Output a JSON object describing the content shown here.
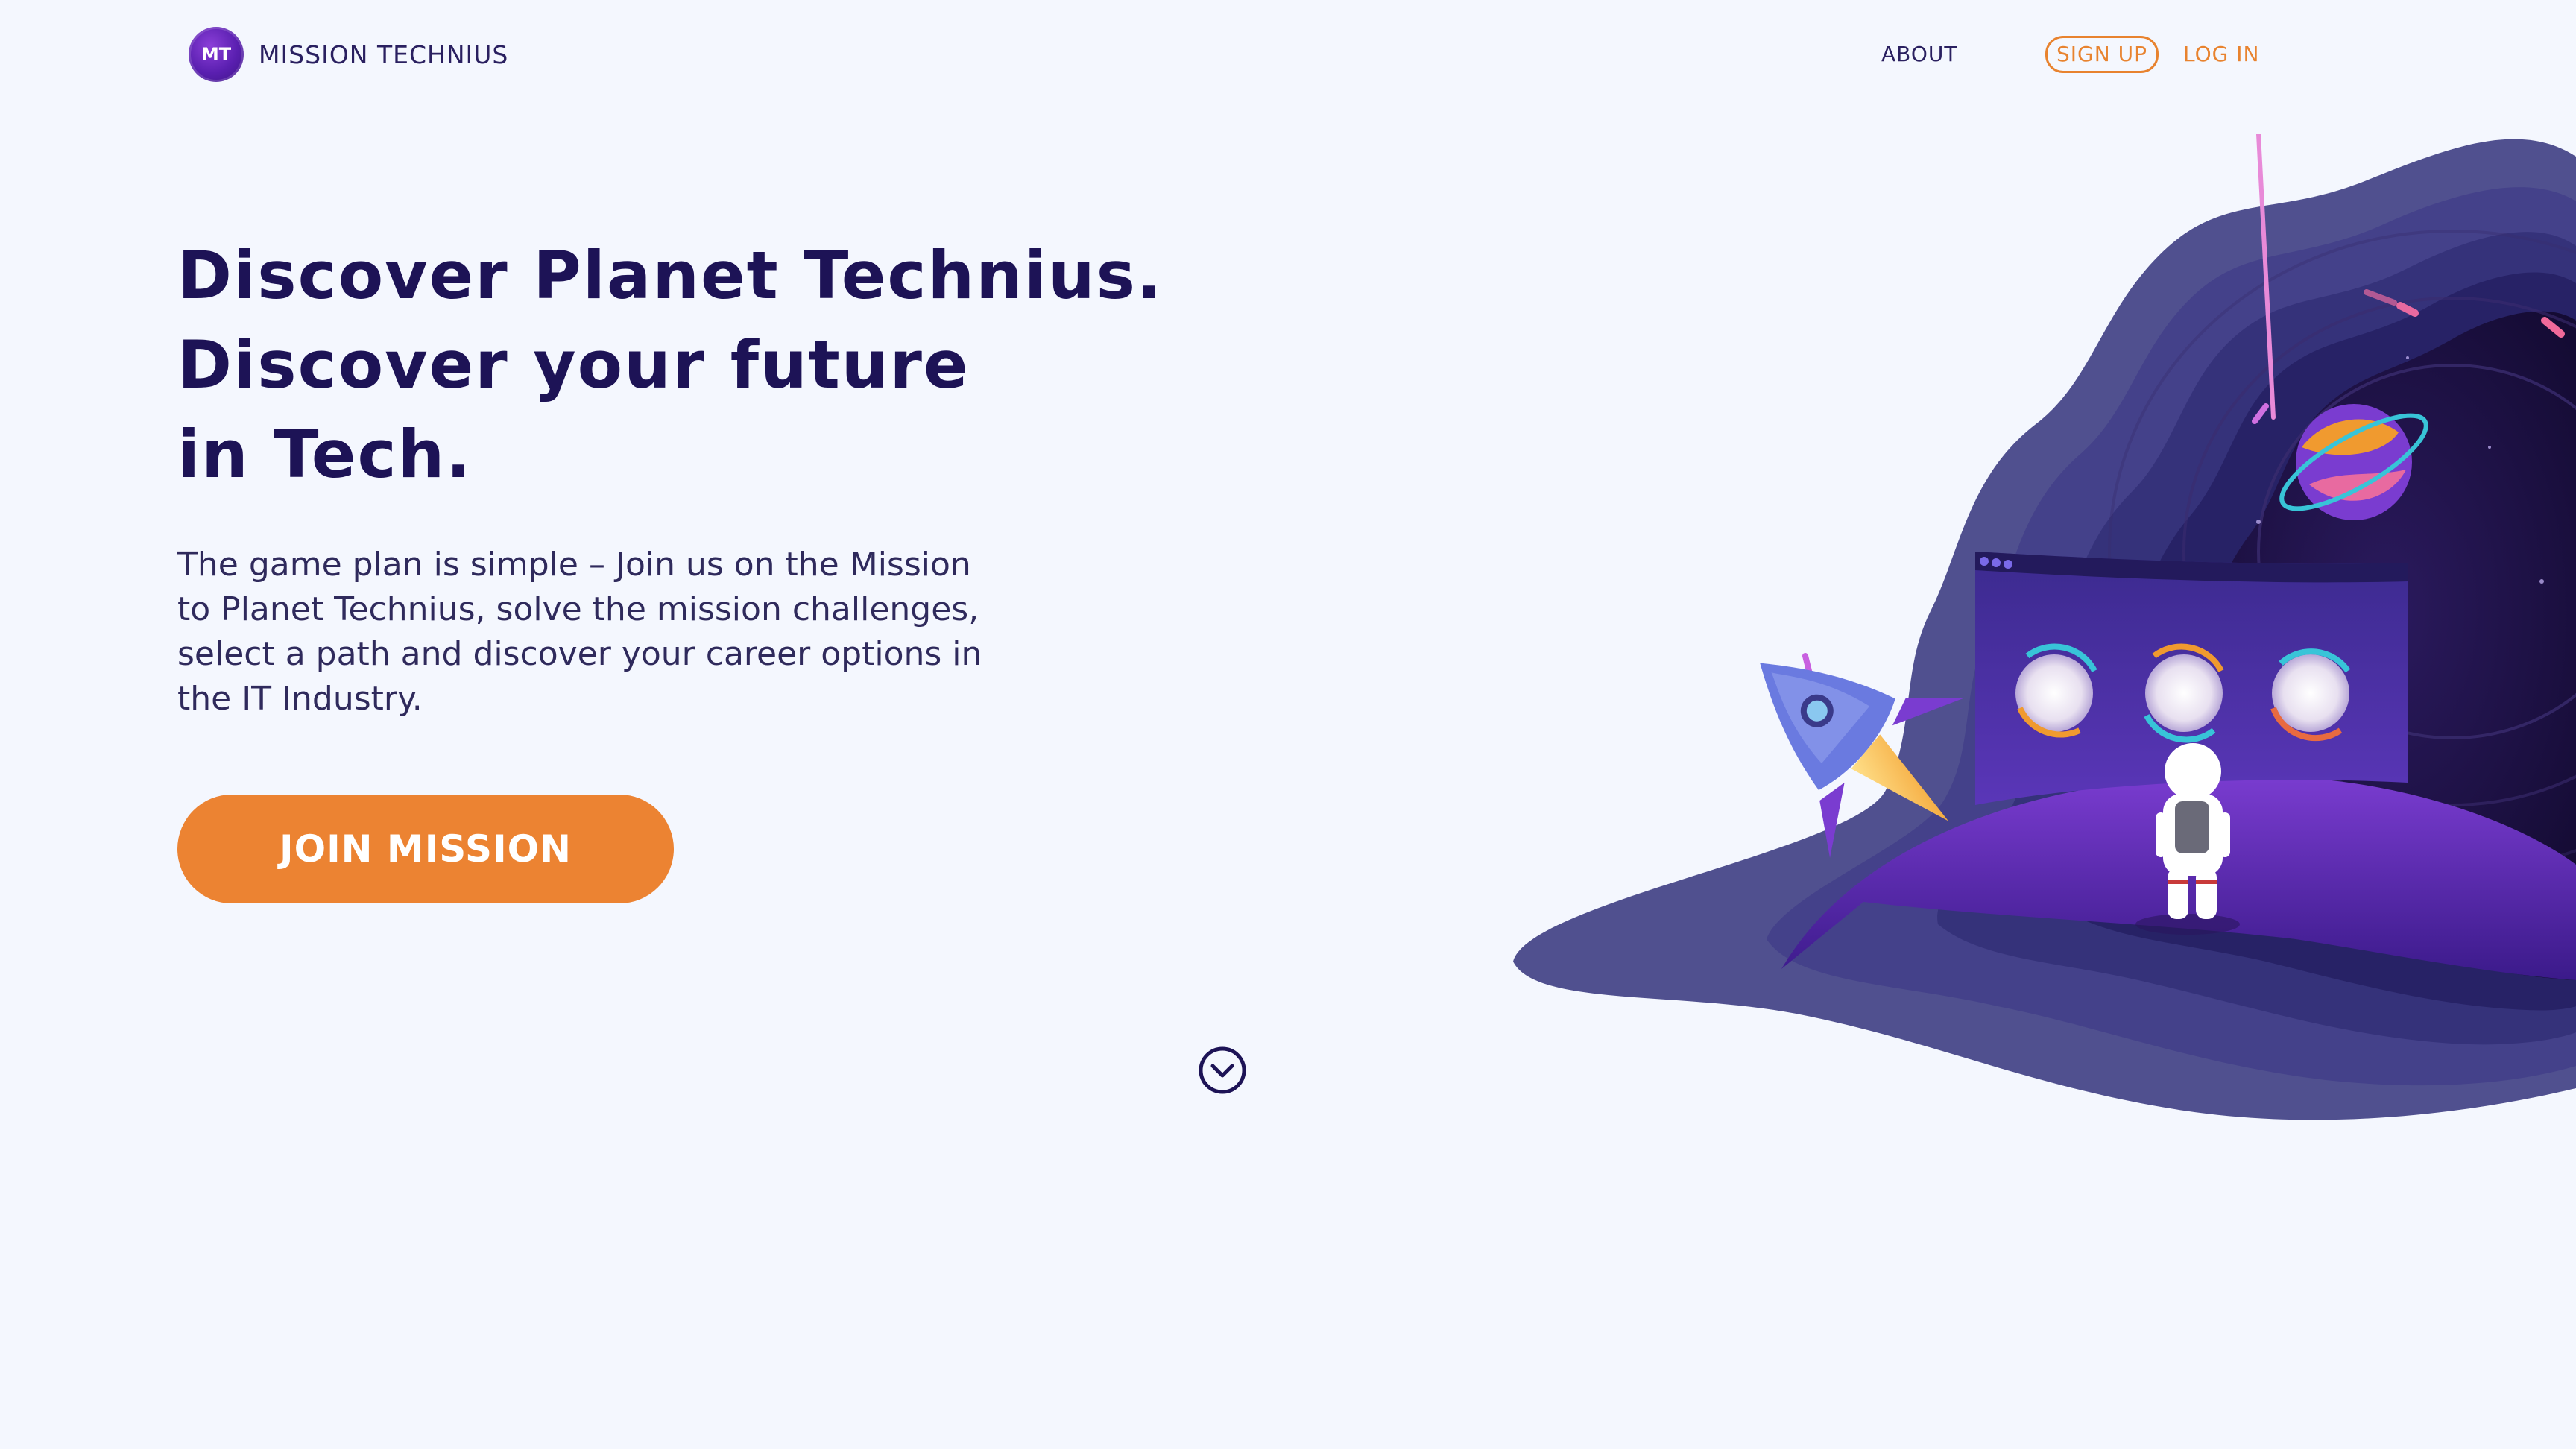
{
  "nav": {
    "logo_initials": "MT",
    "brand": "MISSION TECHNIUS",
    "about": "ABOUT",
    "sign_up": "SIGN UP",
    "log_in": "LOG IN"
  },
  "hero": {
    "title_lines": [
      "Discover Planet Technius.",
      "Discover your future",
      "in Tech."
    ],
    "description": "The game plan is simple – Join us on the Mission to Planet Technius, solve the mission challenges, select a path and discover your career options in the IT Industry.",
    "cta": "JOIN MISSION"
  },
  "icons": {
    "scroll": "chevron-down-circle-icon"
  },
  "colors": {
    "background": "#f4f7fe",
    "heading": "#1d1356",
    "accent": "#ec8332",
    "text": "#2f2a5c"
  }
}
